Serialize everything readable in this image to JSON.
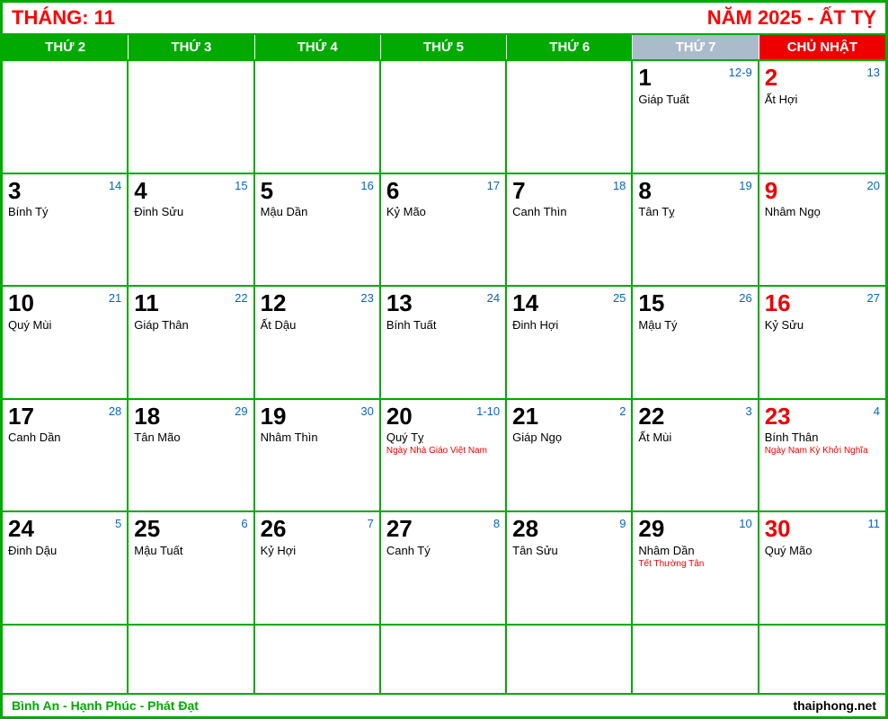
{
  "header": {
    "thang_label": "THÁNG: ",
    "thang_value": "11",
    "nam_label": "NĂM 2025 - ẤT TỴ"
  },
  "day_headers": [
    {
      "label": "THỨ 2"
    },
    {
      "label": "THỨ 3"
    },
    {
      "label": "THỨ 4"
    },
    {
      "label": "THỨ 5"
    },
    {
      "label": "THỨ 6"
    },
    {
      "label": "THỨ 7"
    },
    {
      "label": "CHỦ NHẬT"
    }
  ],
  "weeks": [
    [
      {
        "empty": true
      },
      {
        "empty": true
      },
      {
        "empty": true
      },
      {
        "empty": true
      },
      {
        "empty": true
      },
      {
        "solar": "1",
        "lunar": "12-9",
        "can_chi": "Giáp Tuất",
        "sunday": false
      },
      {
        "solar": "2",
        "lunar": "13",
        "can_chi": "Ất Hợi",
        "sunday": true
      }
    ],
    [
      {
        "solar": "3",
        "lunar": "14",
        "can_chi": "Bính Tý",
        "sunday": false
      },
      {
        "solar": "4",
        "lunar": "15",
        "can_chi": "Đinh Sửu",
        "sunday": false
      },
      {
        "solar": "5",
        "lunar": "16",
        "can_chi": "Mậu Dần",
        "sunday": false
      },
      {
        "solar": "6",
        "lunar": "17",
        "can_chi": "Kỷ Mão",
        "sunday": false
      },
      {
        "solar": "7",
        "lunar": "18",
        "can_chi": "Canh Thìn",
        "sunday": false
      },
      {
        "solar": "8",
        "lunar": "19",
        "can_chi": "Tân Tỵ",
        "sunday": false
      },
      {
        "solar": "9",
        "lunar": "20",
        "can_chi": "Nhâm Ngọ",
        "sunday": true
      }
    ],
    [
      {
        "solar": "10",
        "lunar": "21",
        "can_chi": "Quý Mùi",
        "sunday": false
      },
      {
        "solar": "11",
        "lunar": "22",
        "can_chi": "Giáp Thân",
        "sunday": false
      },
      {
        "solar": "12",
        "lunar": "23",
        "can_chi": "Ất Dậu",
        "sunday": false
      },
      {
        "solar": "13",
        "lunar": "24",
        "can_chi": "Bính Tuất",
        "sunday": false
      },
      {
        "solar": "14",
        "lunar": "25",
        "can_chi": "Đinh Hợi",
        "sunday": false
      },
      {
        "solar": "15",
        "lunar": "26",
        "can_chi": "Mậu Tý",
        "sunday": false
      },
      {
        "solar": "16",
        "lunar": "27",
        "can_chi": "Kỷ Sửu",
        "sunday": true
      }
    ],
    [
      {
        "solar": "17",
        "lunar": "28",
        "can_chi": "Canh Dần",
        "sunday": false
      },
      {
        "solar": "18",
        "lunar": "29",
        "can_chi": "Tân Mão",
        "sunday": false
      },
      {
        "solar": "19",
        "lunar": "30",
        "can_chi": "Nhâm Thìn",
        "sunday": false
      },
      {
        "solar": "20",
        "lunar": "1-10",
        "can_chi": "Quý Tỵ",
        "event": "Ngày Nhà Giáo Việt Nam",
        "sunday": false
      },
      {
        "solar": "21",
        "lunar": "2",
        "can_chi": "Giáp Ngọ",
        "sunday": false
      },
      {
        "solar": "22",
        "lunar": "3",
        "can_chi": "Ất Mùi",
        "sunday": false
      },
      {
        "solar": "23",
        "lunar": "4",
        "can_chi": "Bính Thân",
        "event": "Ngày Nam Kỳ Khởi Nghĩa",
        "sunday": true
      }
    ],
    [
      {
        "solar": "24",
        "lunar": "5",
        "can_chi": "Đinh Dậu",
        "sunday": false
      },
      {
        "solar": "25",
        "lunar": "6",
        "can_chi": "Mậu Tuất",
        "sunday": false
      },
      {
        "solar": "26",
        "lunar": "7",
        "can_chi": "Kỷ Hợi",
        "sunday": false
      },
      {
        "solar": "27",
        "lunar": "8",
        "can_chi": "Canh Tý",
        "sunday": false
      },
      {
        "solar": "28",
        "lunar": "9",
        "can_chi": "Tân Sửu",
        "sunday": false
      },
      {
        "solar": "29",
        "lunar": "10",
        "can_chi": "Nhâm Dần",
        "event": "Tết Thường Tân",
        "sunday": false
      },
      {
        "solar": "30",
        "lunar": "11",
        "can_chi": "Quý Mão",
        "sunday": true
      }
    ],
    [
      {
        "empty": true,
        "last": true
      },
      {
        "empty": true,
        "last": true
      },
      {
        "empty": true,
        "last": true
      },
      {
        "empty": true,
        "last": true
      },
      {
        "empty": true,
        "last": true
      },
      {
        "empty": true,
        "last": true
      },
      {
        "empty": true,
        "last": true
      }
    ]
  ],
  "footer": {
    "left": "Bình An - Hạnh Phúc - Phát Đạt",
    "right": "thaiphong.net"
  }
}
